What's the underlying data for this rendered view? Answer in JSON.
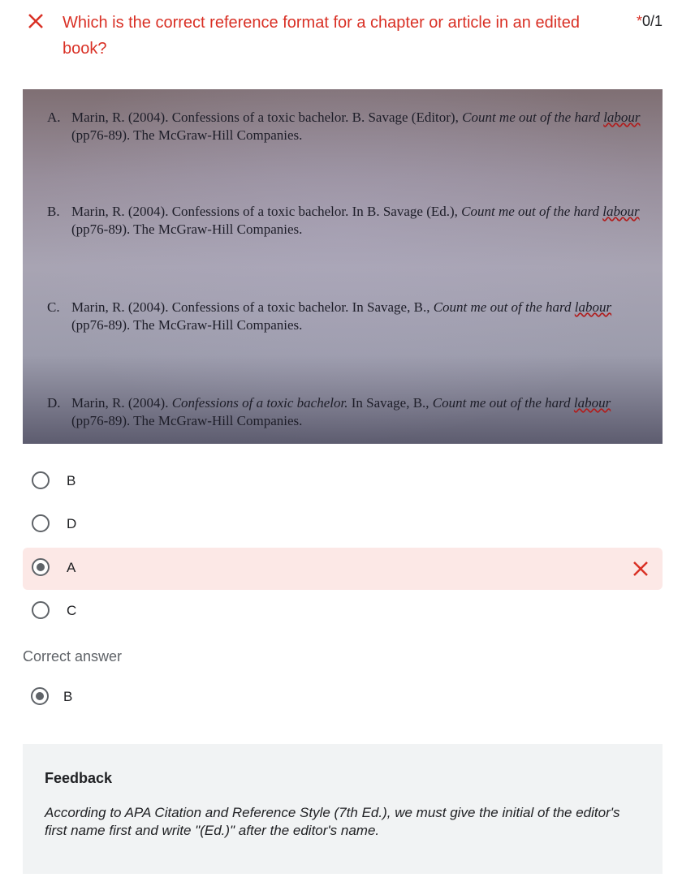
{
  "question": {
    "title": "Which is the correct reference format for a chapter or article in an edited book?",
    "required_mark": "*",
    "score": "0/1",
    "status_icon": "close-icon",
    "status_color": "#d93025"
  },
  "image": {
    "options": [
      {
        "letter": "A.",
        "text_before": "Marin, R. (2004). Confessions of a toxic bachelor. B. Savage (Editor), ",
        "italic": "Count me out of the hard ",
        "italic_ul": "labour",
        "text_after": " (pp76-89). The McGraw-Hill Companies."
      },
      {
        "letter": "B.",
        "text_before": "Marin, R. (2004). Confessions of a toxic bachelor. In B. Savage (Ed.), ",
        "italic": "Count me out of the hard ",
        "italic_ul": "labour",
        "text_after": " (pp76-89). The McGraw-Hill Companies."
      },
      {
        "letter": "C.",
        "text_before": "Marin, R. (2004). Confessions of a toxic bachelor. In Savage, B., ",
        "italic": "Count me out of the hard ",
        "italic_ul": "labour",
        "text_after": " (pp76-89). The McGraw-Hill Companies."
      },
      {
        "letter": "D.",
        "text_before": "Marin, R. (2004). ",
        "title_italic": "Confessions of a toxic bachelor.",
        "text_middle": " In Savage, B., ",
        "italic": "Count me out of the hard ",
        "italic_ul": "labour",
        "text_after": " (pp76-89). The McGraw-Hill Companies."
      }
    ]
  },
  "answers": [
    {
      "label": "B",
      "selected": false
    },
    {
      "label": "D",
      "selected": false
    },
    {
      "label": "A",
      "selected": true,
      "marked_wrong": true
    },
    {
      "label": "C",
      "selected": false
    }
  ],
  "correct": {
    "title": "Correct answer",
    "label": "B"
  },
  "feedback": {
    "title": "Feedback",
    "text": "According to APA Citation and Reference Style (7th Ed.), we must give the initial of the editor's first name first and write \"(Ed.)\" after the editor's name."
  }
}
